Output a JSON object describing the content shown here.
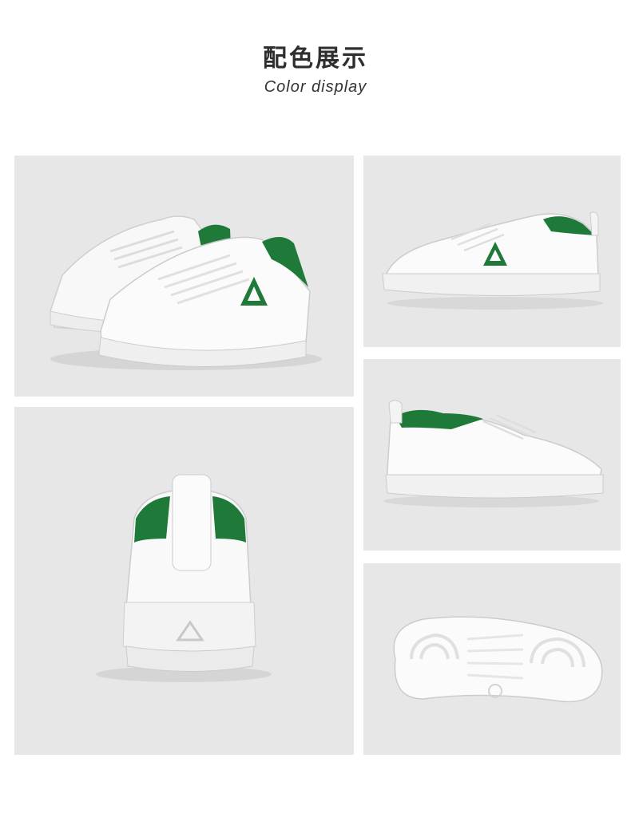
{
  "header": {
    "title_zh": "配色展示",
    "title_en": "Color display"
  },
  "colors": {
    "panel_bg": "#e7e7e7",
    "shoe_white": "#fbfbfb",
    "accent_green": "#1f7a3a",
    "text_dark": "#2e2e2e"
  },
  "gallery": [
    {
      "view": "pair-front-angle",
      "logo_icon": "triangle-logo-icon"
    },
    {
      "view": "side-lateral",
      "logo_icon": "triangle-logo-icon"
    },
    {
      "view": "side-medial",
      "logo_icon": "none"
    },
    {
      "view": "heel-back",
      "logo_icon": "triangle-logo-icon"
    },
    {
      "view": "outsole-bottom",
      "logo_icon": "none"
    }
  ]
}
